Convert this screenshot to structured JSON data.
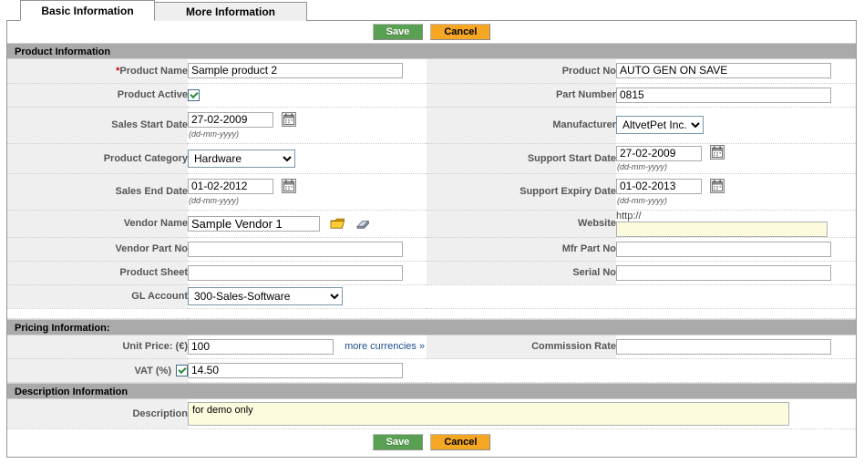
{
  "tabs": [
    {
      "label": "Basic Information",
      "active": true
    },
    {
      "label": "More Information",
      "active": false
    }
  ],
  "toolbar": {
    "save_label": "Save",
    "cancel_label": "Cancel"
  },
  "colors": {
    "save_green": "#5aa052",
    "cancel_orange": "#f5a623",
    "section_header_gray": "#aaaaaa",
    "label_cell_gray": "#efefef",
    "highlight_yellow": "#fdfbdd",
    "required_red": "#cc0000",
    "link_blue": "#1a4f8a"
  },
  "sections": {
    "product": {
      "title": "Product Information"
    },
    "pricing": {
      "title": "Pricing Information:"
    },
    "description": {
      "title": "Description Information"
    }
  },
  "date_hint": "(dd-mm-yyyy)",
  "fields": {
    "product_name": {
      "label": "Product Name",
      "required_marker": "*",
      "value": "Sample product 2"
    },
    "product_no": {
      "label": "Product No",
      "value": "AUTO GEN ON SAVE"
    },
    "product_active": {
      "label": "Product Active",
      "checked": true
    },
    "part_number": {
      "label": "Part Number",
      "value": "0815"
    },
    "sales_start_date": {
      "label": "Sales Start Date",
      "value": "27-02-2009"
    },
    "manufacturer": {
      "label": "Manufacturer",
      "value": "AltvetPet Inc.",
      "options": [
        "AltvetPet Inc."
      ]
    },
    "product_category": {
      "label": "Product Category",
      "value": "Hardware",
      "options": [
        "Hardware"
      ]
    },
    "support_start_date": {
      "label": "Support Start Date",
      "value": "27-02-2009"
    },
    "sales_end_date": {
      "label": "Sales End Date",
      "value": "01-02-2012"
    },
    "support_expiry_date": {
      "label": "Support Expiry Date",
      "value": "01-02-2013"
    },
    "vendor_name": {
      "label": "Vendor Name",
      "value": "Sample Vendor 1"
    },
    "website": {
      "label": "Website",
      "prefix": "http://",
      "value": ""
    },
    "vendor_part_no": {
      "label": "Vendor Part No",
      "value": ""
    },
    "mfr_part_no": {
      "label": "Mfr Part No",
      "value": ""
    },
    "product_sheet": {
      "label": "Product Sheet",
      "value": ""
    },
    "serial_no": {
      "label": "Serial No",
      "value": ""
    },
    "gl_account": {
      "label": "GL Account",
      "value": "300-Sales-Software",
      "options": [
        "300-Sales-Software"
      ]
    },
    "unit_price": {
      "label": "Unit Price: (€)",
      "value": "100",
      "more_currencies": "more currencies »"
    },
    "commission_rate": {
      "label": "Commission Rate",
      "value": ""
    },
    "vat": {
      "label": "VAT (%)",
      "checked": true,
      "value": "14.50"
    },
    "description": {
      "label": "Description",
      "value": "for demo only"
    }
  }
}
